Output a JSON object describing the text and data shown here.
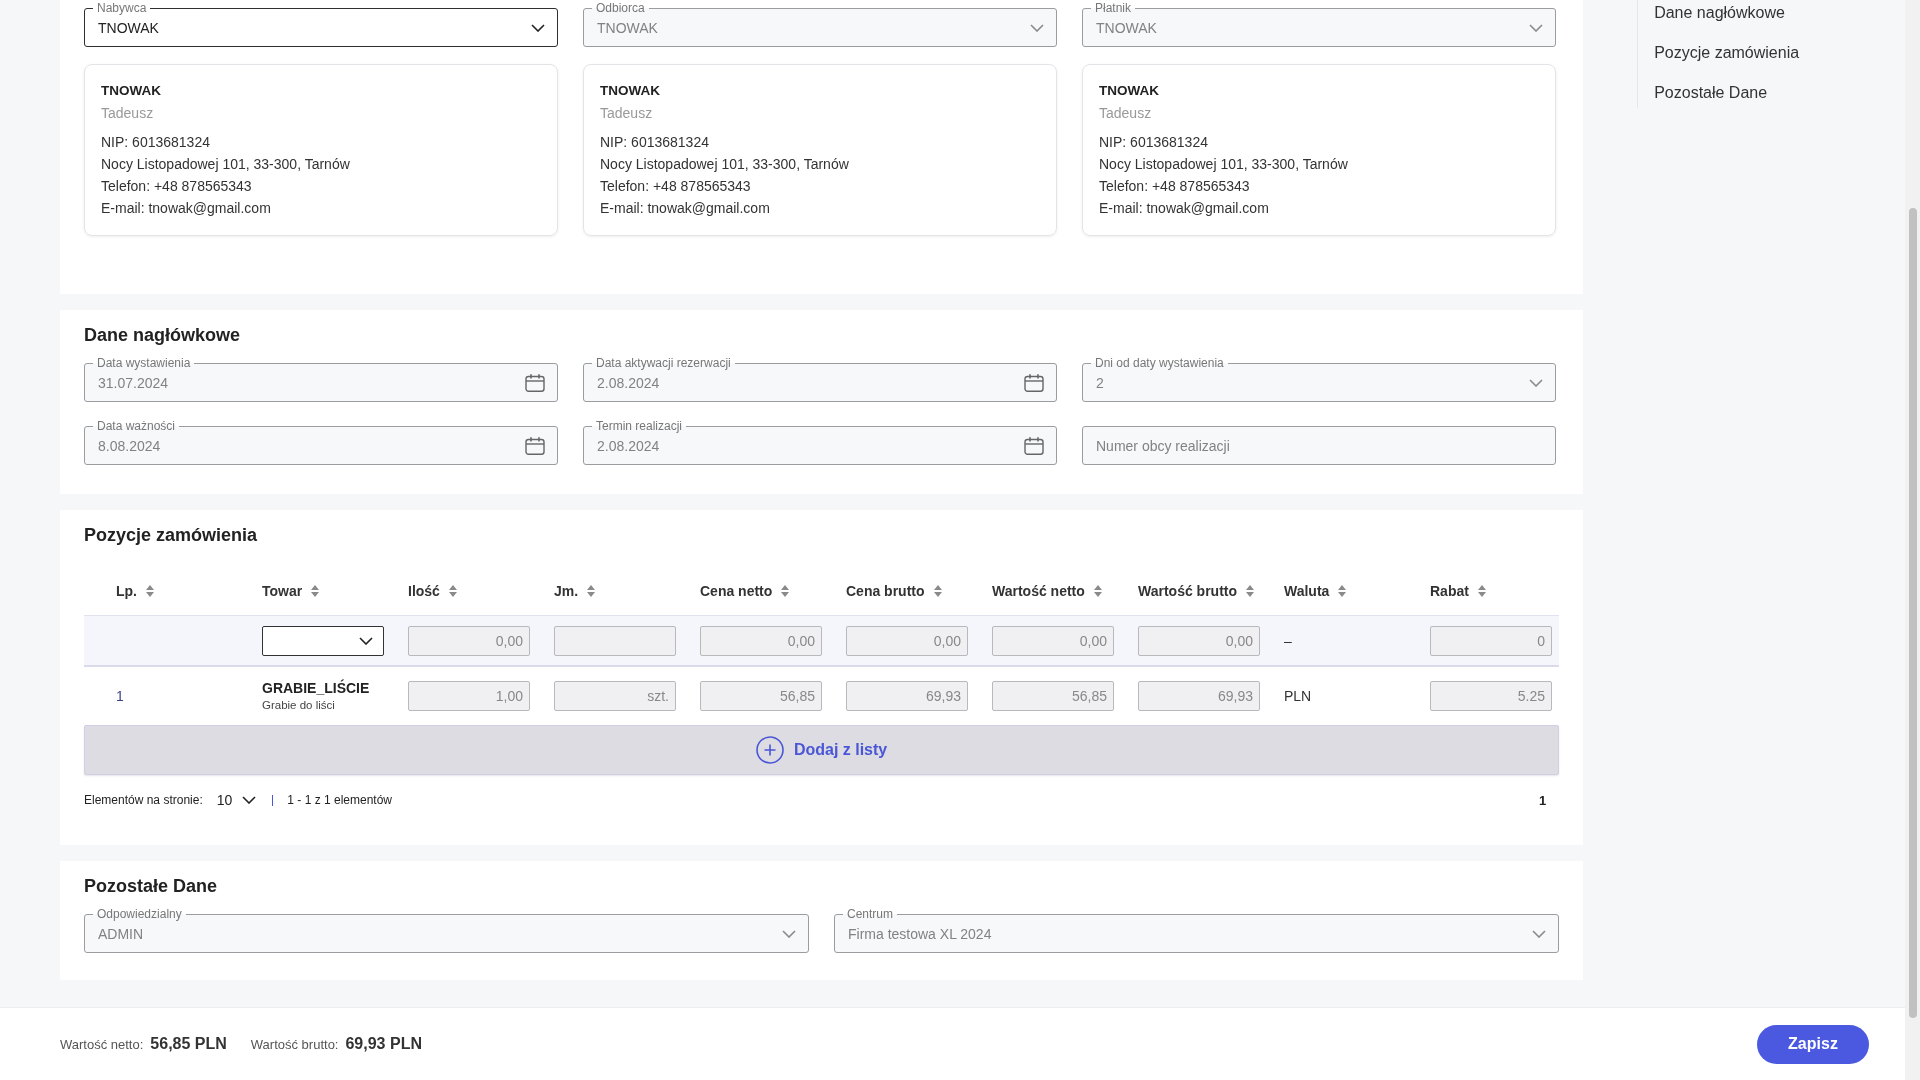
{
  "parties": [
    {
      "label": "Nabywca",
      "value": "TNOWAK",
      "disabled": false,
      "card": {
        "name": "TNOWAK",
        "first_name": "Tadeusz",
        "details": [
          "NIP: 6013681324",
          "Nocy Listopadowej 101, 33-300, Tarnów",
          "Telefon: +48 878565343",
          "E-mail: tnowak@gmail.com"
        ]
      }
    },
    {
      "label": "Odbiorca",
      "value": "TNOWAK",
      "disabled": true,
      "card": {
        "name": "TNOWAK",
        "first_name": "Tadeusz",
        "details": [
          "NIP: 6013681324",
          "Nocy Listopadowej 101, 33-300, Tarnów",
          "Telefon: +48 878565343",
          "E-mail: tnowak@gmail.com"
        ]
      }
    },
    {
      "label": "Płatnik",
      "value": "TNOWAK",
      "disabled": true,
      "card": {
        "name": "TNOWAK",
        "first_name": "Tadeusz",
        "details": [
          "NIP: 6013681324",
          "Nocy Listopadowej 101, 33-300, Tarnów",
          "Telefon: +48 878565343",
          "E-mail: tnowak@gmail.com"
        ]
      }
    }
  ],
  "side_nav": {
    "items": [
      {
        "label": "Dane nagłówkowe",
        "selected": false
      },
      {
        "label": "Pozycje zamówienia",
        "selected": false
      },
      {
        "label": "Pozostałe Dane",
        "selected": false
      }
    ]
  },
  "header_section": {
    "title": "Dane nagłówkowe",
    "fields": [
      {
        "kind": "date",
        "label": "Data wystawienia",
        "value": "31.07.2024",
        "disabled": true
      },
      {
        "kind": "date",
        "label": "Data aktywacji rezerwacji",
        "value": "2.08.2024",
        "disabled": true
      },
      {
        "kind": "select",
        "label": "Dni od daty wystawienia",
        "value": "2",
        "disabled": true
      },
      {
        "kind": "date",
        "label": "Data ważności",
        "value": "8.08.2024",
        "disabled": true
      },
      {
        "kind": "date",
        "label": "Termin realizacji",
        "value": "2.08.2024",
        "disabled": true
      },
      {
        "kind": "text",
        "placeholder": "Numer obcy realizacji",
        "disabled": true
      }
    ]
  },
  "items_section": {
    "title": "Pozycje zamówienia",
    "table": {
      "columns": [
        "Lp.",
        "Towar",
        "Ilość",
        "Jm.",
        "Cena netto",
        "Cena brutto",
        "Wartość netto",
        "Wartość brutto",
        "Waluta",
        "Rabat"
      ],
      "filter_row": [
        {
          "kind": "empty"
        },
        {
          "kind": "select"
        },
        {
          "kind": "input",
          "value": "0,00"
        },
        {
          "kind": "input"
        },
        {
          "kind": "input",
          "value": "0,00"
        },
        {
          "kind": "input",
          "value": "0,00"
        },
        {
          "kind": "input",
          "value": "0,00"
        },
        {
          "kind": "input",
          "value": "0,00"
        },
        {
          "kind": "text",
          "value": "–"
        },
        {
          "kind": "input",
          "value": "0"
        }
      ],
      "rows": [
        {
          "cells": [
            {
              "kind": "text",
              "value": "1"
            },
            {
              "kind": "product",
              "name": "GRABIE_LIŚCIE",
              "description": "Grabie do liści"
            },
            {
              "kind": "input",
              "value": "1,00"
            },
            {
              "kind": "input",
              "value": "szt."
            },
            {
              "kind": "input",
              "value": "56,85"
            },
            {
              "kind": "input",
              "value": "69,93"
            },
            {
              "kind": "input",
              "value": "56,85"
            },
            {
              "kind": "input",
              "value": "69,93"
            },
            {
              "kind": "text",
              "value": "PLN"
            },
            {
              "kind": "input",
              "value": "5.25"
            }
          ]
        }
      ]
    },
    "add_button": "Dodaj z listy",
    "pagination": {
      "page_size_label": "Elementów na stronie:",
      "page_size": "10",
      "range": "1 - 1 z 1 elementów",
      "pages": [
        {
          "label": "1",
          "selected": true
        }
      ]
    }
  },
  "other_section": {
    "title": "Pozostałe Dane",
    "fields": [
      {
        "kind": "select",
        "label": "Odpowiedzialny",
        "value": "ADMIN",
        "disabled": true
      },
      {
        "kind": "select",
        "label": "Centrum",
        "value": "Firma testowa XL 2024",
        "disabled": true
      }
    ]
  },
  "footer": {
    "totals": [
      {
        "label": "Wartość netto:",
        "value": "56,85 PLN"
      },
      {
        "label": "Wartość brutto:",
        "value": "69,93 PLN"
      }
    ],
    "save_button": "Zapisz"
  }
}
